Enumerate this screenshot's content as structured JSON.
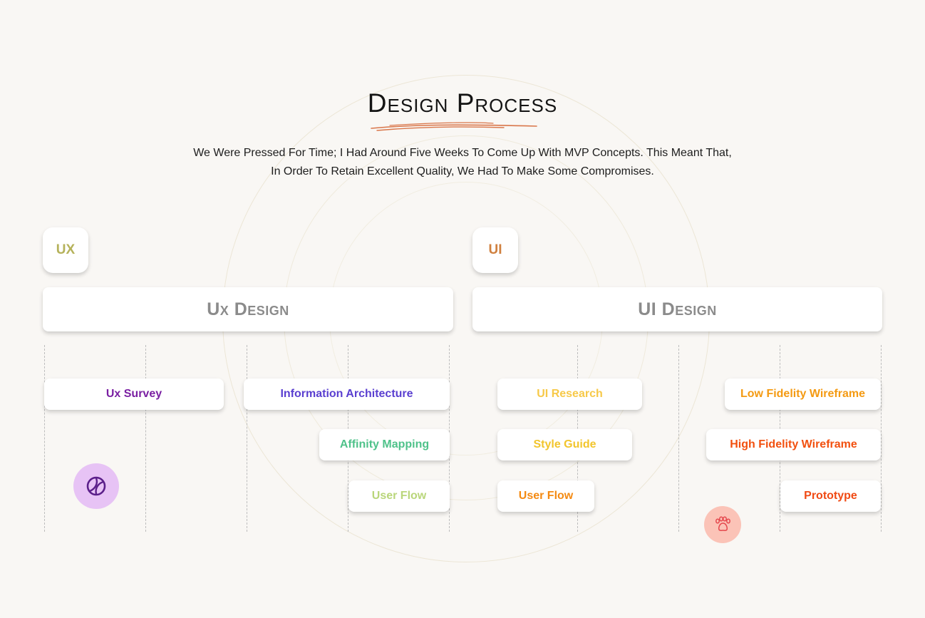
{
  "header": {
    "title": "Design Process",
    "subtitle_line1": "We Were Pressed For Time; I Had Around Five Weeks To Come Up With MVP Concepts. This Meant That,",
    "subtitle_line2": "In Order To Retain Excellent Quality, We Had To Make Some Compromises."
  },
  "colors": {
    "title_underline": "#d9764a",
    "ux_badge": "#b5b25a",
    "ui_badge": "#d0803f",
    "bar_text": "#8b8b8b",
    "purple_circle": "#e7c3f5",
    "pink_circle": "#fbc3b7"
  },
  "ux": {
    "badge": "UX",
    "bar_label": "Ux Design",
    "items": [
      {
        "label": "Ux Survey",
        "color": "#7a1fa2"
      },
      {
        "label": "Information Architecture",
        "color": "#5a3fd0"
      },
      {
        "label": "Affinity Mapping",
        "color": "#4fc28a"
      },
      {
        "label": "User Flow",
        "color": "#b9d67a"
      }
    ]
  },
  "ui": {
    "badge": "UI",
    "bar_label": "UI Design",
    "items": [
      {
        "label": "UI Research",
        "color": "#f7c948"
      },
      {
        "label": "Style Guide",
        "color": "#f2c52c"
      },
      {
        "label": "User Flow",
        "color": "#f48a12"
      },
      {
        "label": "Low Fidelity Wireframe",
        "color": "#f49a12"
      },
      {
        "label": "High Fidelity Wireframe",
        "color": "#f2500f"
      },
      {
        "label": "Prototype",
        "color": "#f04a14"
      }
    ]
  },
  "icons": {
    "ball": "tennis-ball-icon",
    "paw": "paw-icon"
  }
}
